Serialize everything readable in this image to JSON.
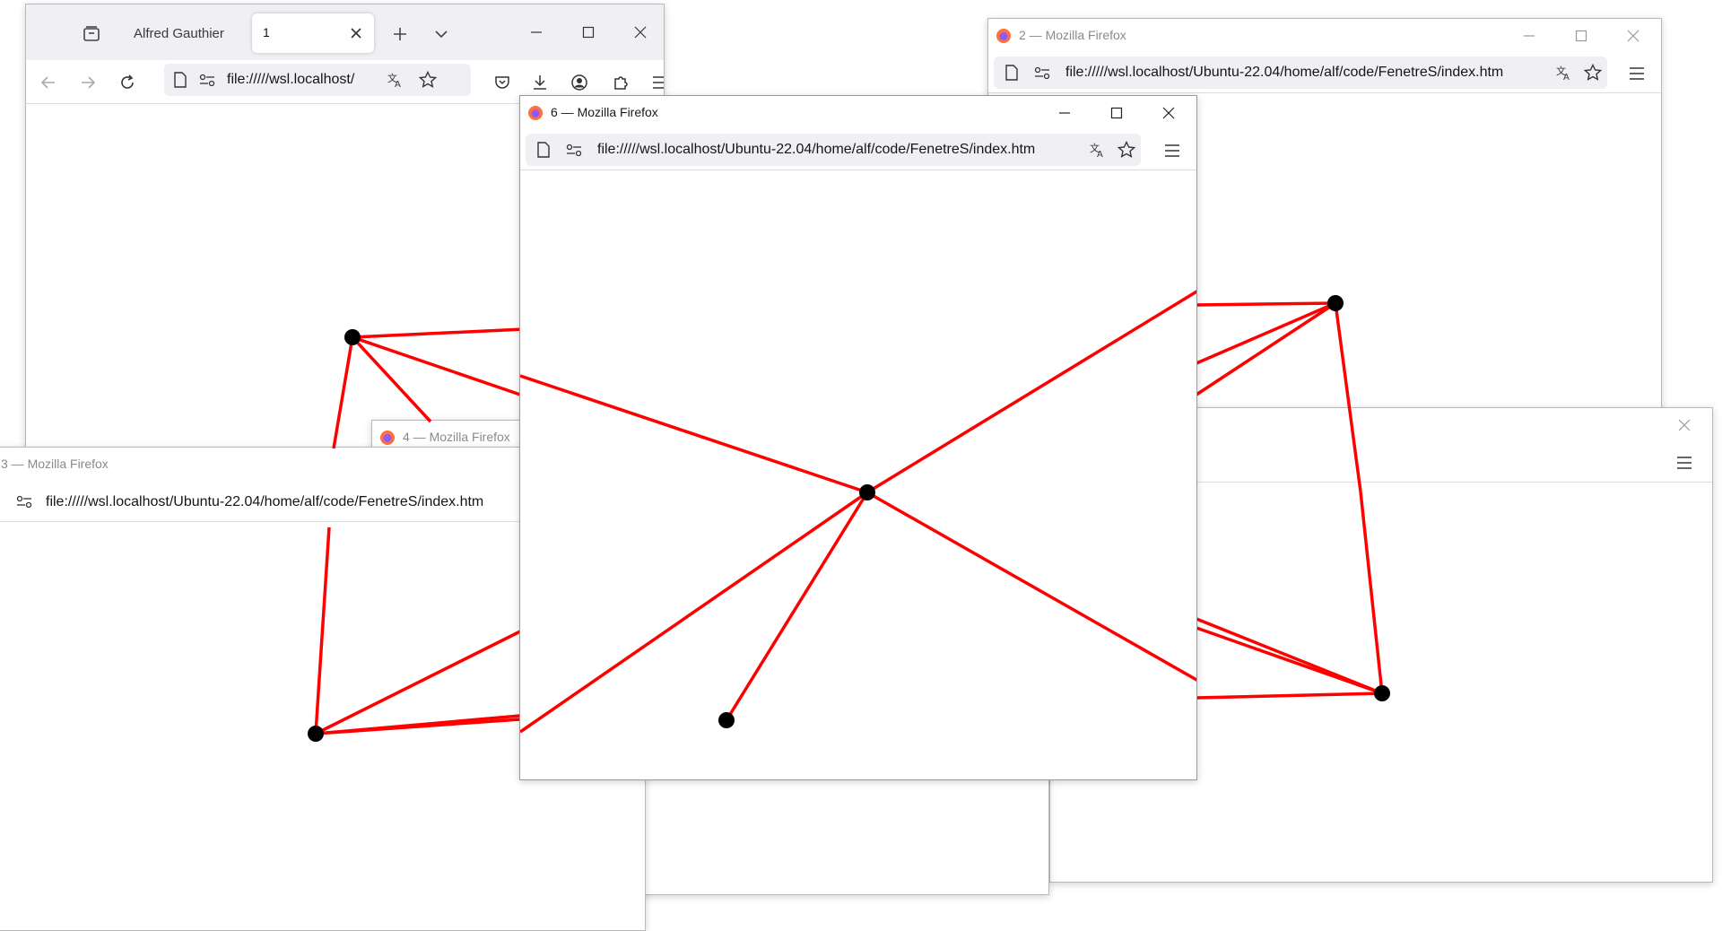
{
  "window_main": {
    "profile": "Alfred Gauthier",
    "tab_label": "1",
    "url": "file://///wsl.localhost/"
  },
  "window_2": {
    "title": "2 — Mozilla Firefox",
    "url": "file://///wsl.localhost/Ubuntu-22.04/home/alf/code/FenetreS/index.htm"
  },
  "window_3": {
    "title": "3 — Mozilla Firefox",
    "url": "file://///wsl.localhost/Ubuntu-22.04/home/alf/code/FenetreS/index.htm"
  },
  "window_4": {
    "title": "4 — Mozilla Firefox"
  },
  "window_6": {
    "title": "6 — Mozilla Firefox",
    "url": "file://///wsl.localhost/Ubuntu-22.04/home/alf/code/FenetreS/index.htm"
  },
  "colors": {
    "line": "#ff0000",
    "node": "#000000",
    "toolbar_bg": "#f0f0f4"
  }
}
